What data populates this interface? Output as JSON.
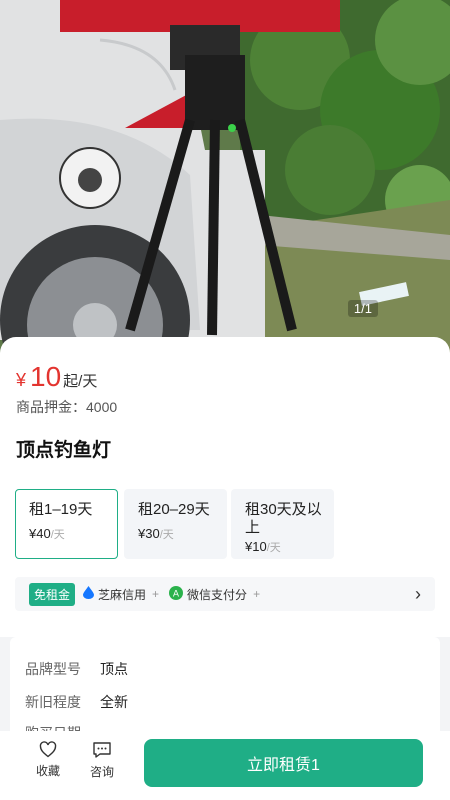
{
  "gallery": {
    "counter": "1/1"
  },
  "product": {
    "price_symbol": "¥",
    "price_value": "10",
    "price_unit": "起/天",
    "deposit": "商品押金：4000",
    "title": "顶点钓鱼灯"
  },
  "plans": [
    {
      "label": "租1–19天",
      "price": "¥40",
      "per": "/天",
      "selected": true
    },
    {
      "label": "租20–29天",
      "price": "¥30",
      "per": "/天",
      "selected": false
    },
    {
      "label": "租30天及以上",
      "price": "¥10",
      "per": "/天",
      "selected": false
    }
  ],
  "credit": {
    "badge": "免租金",
    "zhima": "芝麻信用",
    "wechat": "微信支付分",
    "plus": "+"
  },
  "details": [
    {
      "key": "品牌型号",
      "value": "顶点"
    },
    {
      "key": "新旧程度",
      "value": "全新"
    },
    {
      "key": "购买日期",
      "value": ""
    }
  ],
  "bottom_bar": {
    "favorite": "收藏",
    "consult": "咨询",
    "rent_now": "立即租赁1"
  },
  "colors": {
    "accent": "#1fae86",
    "price": "#e3342f"
  }
}
